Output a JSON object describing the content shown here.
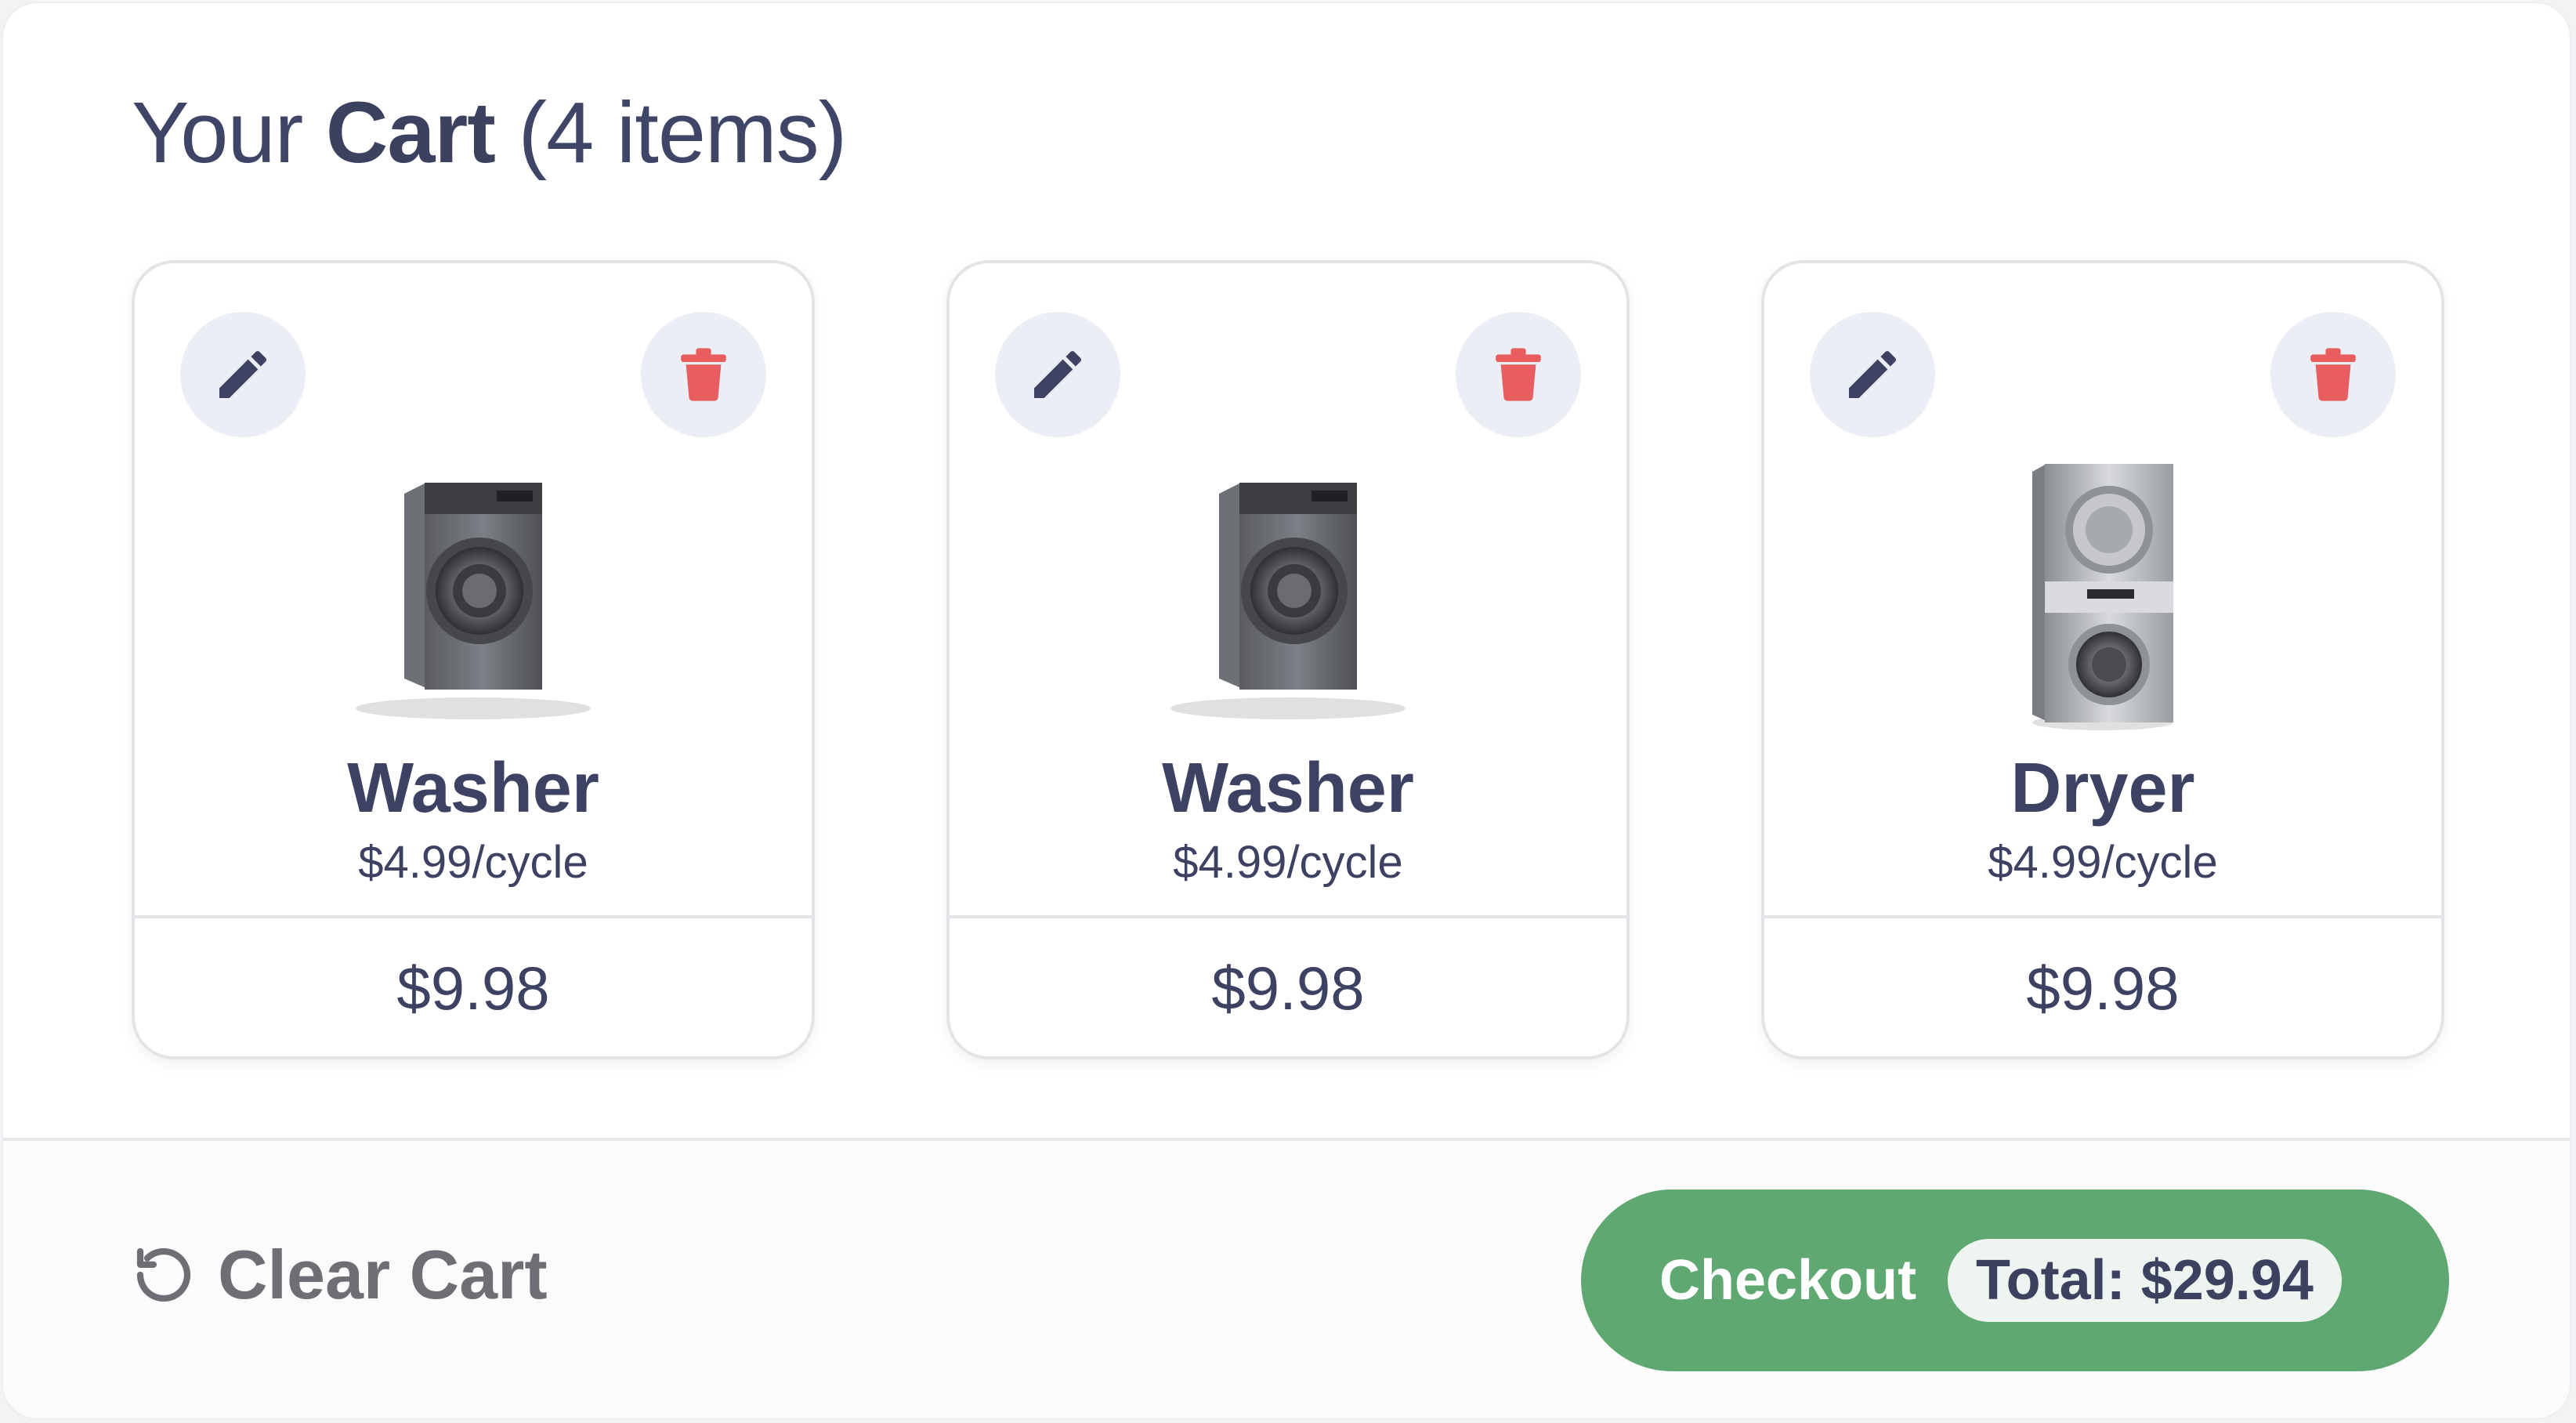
{
  "header": {
    "prefix": "Your",
    "strong": "Cart",
    "count": "(4 items)"
  },
  "cart": {
    "items": [
      {
        "name": "Washer",
        "rate": "$4.99/cycle",
        "subtotal": "$9.98",
        "image": "washer-image"
      },
      {
        "name": "Washer",
        "rate": "$4.99/cycle",
        "subtotal": "$9.98",
        "image": "washer-image"
      },
      {
        "name": "Dryer",
        "rate": "$4.99/cycle",
        "subtotal": "$9.98",
        "image": "stacked-dryer-image"
      }
    ]
  },
  "icons": {
    "edit": "pencil-icon",
    "delete": "trash-icon",
    "clear": "undo-arrow-icon"
  },
  "footer": {
    "clear_label": "Clear Cart",
    "checkout_label": "Checkout",
    "total_label": "Total: $29.94"
  },
  "colors": {
    "accent_green": "#60a872",
    "delete_red": "#e85e5e",
    "text_dark": "#3d4263"
  }
}
